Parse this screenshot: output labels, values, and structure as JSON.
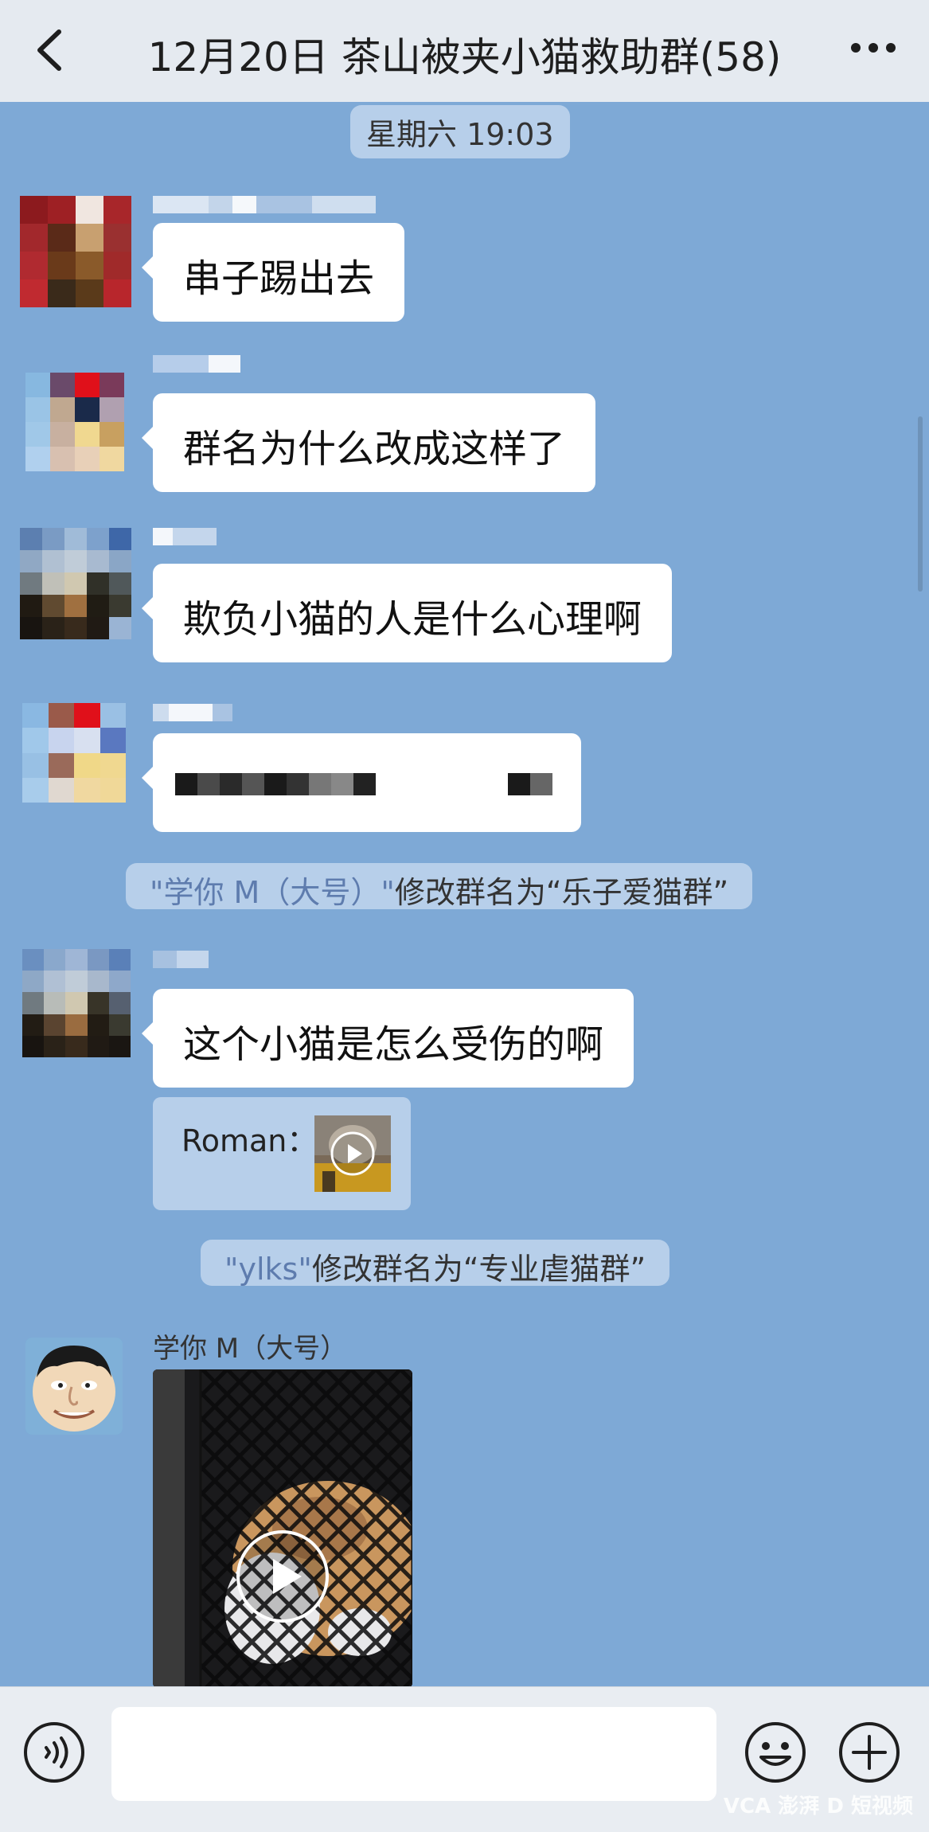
{
  "header": {
    "title": "12月20日 茶山被夹小猫救助群(58)"
  },
  "chat": {
    "timestamp": "星期六 19:03",
    "messages": [
      {
        "text": "串子踢出去"
      },
      {
        "text": "群名为什么改成这样了"
      },
      {
        "text": "欺负小猫的人是什么心理啊"
      },
      {
        "text": ""
      },
      {
        "text": "这个小猫是怎么受伤的啊"
      }
    ],
    "quote": {
      "sender": "Roman："
    },
    "notices": [
      {
        "actor": "\"学你 M（大号）\"",
        "action": "修改群名为“乐子爱猫群”"
      },
      {
        "actor": "\"ylks\"",
        "action": "修改群名为“专业虐猫群”"
      }
    ],
    "last_sender": "学你 M（大号）"
  },
  "composer": {
    "placeholder": ""
  },
  "watermark": "VCA 澎湃  D 短视频",
  "colors": {
    "chat_background": "#7ea9d6",
    "bubble": "#ffffff",
    "notice_pill": "#b7cfea",
    "notice_name": "#5e7cae"
  },
  "icons": {
    "back": "chevron-left-icon",
    "more": "more-dots-icon",
    "voice": "voice-icon",
    "emoji": "emoji-icon",
    "add": "plus-icon"
  }
}
